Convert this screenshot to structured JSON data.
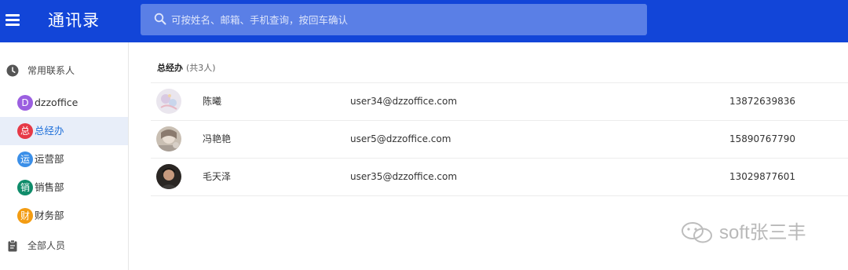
{
  "header": {
    "title": "通讯录",
    "search_placeholder": "可按姓名、邮箱、手机查询，按回车确认"
  },
  "sidebar": {
    "sections": [
      {
        "label": "常用联系人",
        "icon": "clock-icon"
      },
      {
        "label": "全部人员",
        "icon": "clipboard-icon"
      }
    ],
    "items": [
      {
        "badge": "D",
        "label": "dzzoffice",
        "color": "#9b5fe0",
        "active": false
      },
      {
        "badge": "总",
        "label": "总经办",
        "color": "#e63946",
        "active": true
      },
      {
        "badge": "运",
        "label": "运营部",
        "color": "#3b8fe8",
        "active": false
      },
      {
        "badge": "销",
        "label": "销售部",
        "color": "#0f8c6a",
        "active": false
      },
      {
        "badge": "财",
        "label": "财务部",
        "color": "#f39c12",
        "active": false
      }
    ]
  },
  "main": {
    "group_title": "总经办",
    "group_count": "(共3人)",
    "contacts": [
      {
        "name": "陈曦",
        "email": "user34@dzzoffice.com",
        "phone": "13872639836"
      },
      {
        "name": "冯艳艳",
        "email": "user5@dzzoffice.com",
        "phone": "15890767790"
      },
      {
        "name": "毛天泽",
        "email": "user35@dzzoffice.com",
        "phone": "13029877601"
      }
    ]
  },
  "watermark": {
    "text": "soft张三丰"
  },
  "colors": {
    "header": "#1245d8",
    "search_bg": "#5a7fe6",
    "active_bg": "#e8eef9",
    "active_text": "#1e6fd9"
  }
}
